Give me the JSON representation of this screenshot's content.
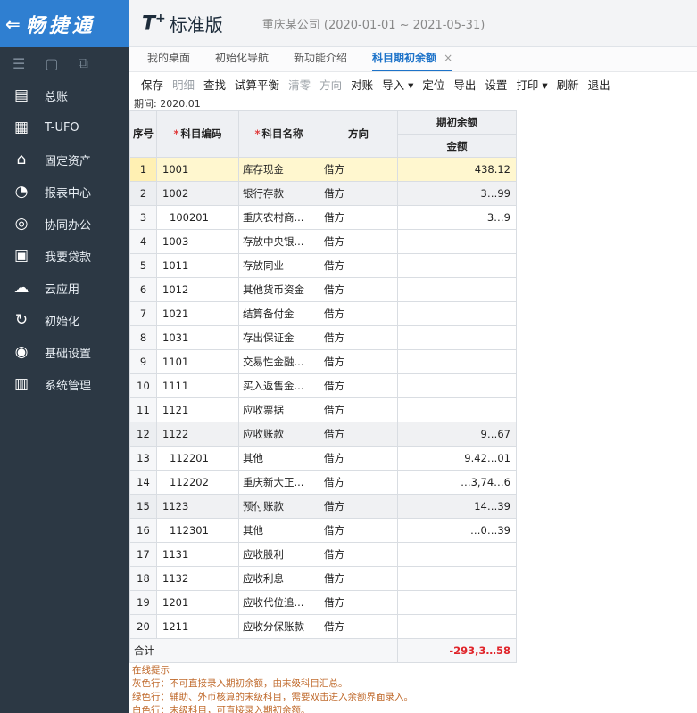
{
  "brand": {
    "arrow": "⇐",
    "name": "畅捷通"
  },
  "header": {
    "logo": "T",
    "logo_sup": "+",
    "edition": "标准版",
    "account_text": "重庆某公司 (2020-01-01 ~ 2021-05-31)"
  },
  "sidebar": {
    "tool_icons": [
      "menu-icon",
      "calendar-icon",
      "share-icon"
    ],
    "items": [
      {
        "icon": "ledger-icon",
        "glyph": "▤",
        "label": "总账"
      },
      {
        "icon": "ufo-icon",
        "glyph": "▦",
        "label": "T-UFO"
      },
      {
        "icon": "bank-icon",
        "glyph": "⌂",
        "label": "固定资产"
      },
      {
        "icon": "chart-icon",
        "glyph": "◔",
        "label": "报表中心"
      },
      {
        "icon": "collab-icon",
        "glyph": "◎",
        "label": "协同办公"
      },
      {
        "icon": "loan-icon",
        "glyph": "▣",
        "label": "我要贷款"
      },
      {
        "icon": "cloud-icon",
        "glyph": "☁",
        "label": "云应用"
      },
      {
        "icon": "init-icon",
        "glyph": "↻",
        "label": "初始化"
      },
      {
        "icon": "settings-icon",
        "glyph": "◉",
        "label": "基础设置"
      },
      {
        "icon": "system-icon",
        "glyph": "▥",
        "label": "系统管理"
      }
    ]
  },
  "tabs": [
    {
      "label": "我的桌面",
      "active": false
    },
    {
      "label": "初始化导航",
      "active": false
    },
    {
      "label": "新功能介绍",
      "active": false
    },
    {
      "label": "科目期初余额",
      "active": true,
      "close": "×"
    }
  ],
  "toolbar": [
    {
      "label": "保存",
      "enabled": true
    },
    {
      "label": "明细",
      "enabled": false
    },
    {
      "label": "查找",
      "enabled": true
    },
    {
      "label": "试算平衡",
      "enabled": true
    },
    {
      "label": "清零",
      "enabled": false
    },
    {
      "label": "方向",
      "enabled": false
    },
    {
      "label": "对账",
      "enabled": true
    },
    {
      "label": "导入 ▾",
      "enabled": true
    },
    {
      "label": "定位",
      "enabled": true
    },
    {
      "label": "导出",
      "enabled": true
    },
    {
      "label": "设置",
      "enabled": true
    },
    {
      "label": "打印 ▾",
      "enabled": true
    },
    {
      "label": "刷新",
      "enabled": true
    },
    {
      "label": "退出",
      "enabled": true
    }
  ],
  "period": "期间: 2020.01",
  "table": {
    "headers": {
      "index": "序号",
      "code": "科目编码",
      "name": "科目名称",
      "direction": "方向",
      "balance_group": "期初余额",
      "amount": "金额"
    },
    "rows": [
      {
        "index": "1",
        "code": "1001",
        "name": "库存现金",
        "direction": "借方",
        "amount": "438.12",
        "sub": false,
        "state": "sel"
      },
      {
        "index": "2",
        "code": "1002",
        "name": "银行存款",
        "direction": "借方",
        "amount": "3…99",
        "sub": false,
        "state": "gray"
      },
      {
        "index": "3",
        "code": "100201",
        "name": "重庆农村商...",
        "direction": "借方",
        "amount": "3…9",
        "sub": true,
        "state": ""
      },
      {
        "index": "4",
        "code": "1003",
        "name": "存放中央银...",
        "direction": "借方",
        "amount": "",
        "sub": false,
        "state": ""
      },
      {
        "index": "5",
        "code": "1011",
        "name": "存放同业",
        "direction": "借方",
        "amount": "",
        "sub": false,
        "state": ""
      },
      {
        "index": "6",
        "code": "1012",
        "name": "其他货币资金",
        "direction": "借方",
        "amount": "",
        "sub": false,
        "state": ""
      },
      {
        "index": "7",
        "code": "1021",
        "name": "结算备付金",
        "direction": "借方",
        "amount": "",
        "sub": false,
        "state": ""
      },
      {
        "index": "8",
        "code": "1031",
        "name": "存出保证金",
        "direction": "借方",
        "amount": "",
        "sub": false,
        "state": ""
      },
      {
        "index": "9",
        "code": "1101",
        "name": "交易性金融...",
        "direction": "借方",
        "amount": "",
        "sub": false,
        "state": ""
      },
      {
        "index": "10",
        "code": "1111",
        "name": "买入返售金...",
        "direction": "借方",
        "amount": "",
        "sub": false,
        "state": ""
      },
      {
        "index": "11",
        "code": "1121",
        "name": "应收票据",
        "direction": "借方",
        "amount": "",
        "sub": false,
        "state": ""
      },
      {
        "index": "12",
        "code": "1122",
        "name": "应收账款",
        "direction": "借方",
        "amount": "9…67",
        "sub": false,
        "state": "gray"
      },
      {
        "index": "13",
        "code": "112201",
        "name": "其他",
        "direction": "借方",
        "amount": "9.42…01",
        "sub": true,
        "state": ""
      },
      {
        "index": "14",
        "code": "112202",
        "name": "重庆新大正...",
        "direction": "借方",
        "amount": "…3,74…6",
        "sub": true,
        "state": ""
      },
      {
        "index": "15",
        "code": "1123",
        "name": "预付账款",
        "direction": "借方",
        "amount": "14…39",
        "sub": false,
        "state": "gray"
      },
      {
        "index": "16",
        "code": "112301",
        "name": "其他",
        "direction": "借方",
        "amount": "…0…39",
        "sub": true,
        "state": ""
      },
      {
        "index": "17",
        "code": "1131",
        "name": "应收股利",
        "direction": "借方",
        "amount": "",
        "sub": false,
        "state": ""
      },
      {
        "index": "18",
        "code": "1132",
        "name": "应收利息",
        "direction": "借方",
        "amount": "",
        "sub": false,
        "state": ""
      },
      {
        "index": "19",
        "code": "1201",
        "name": "应收代位追...",
        "direction": "借方",
        "amount": "",
        "sub": false,
        "state": ""
      },
      {
        "index": "20",
        "code": "1211",
        "name": "应收分保账款",
        "direction": "借方",
        "amount": "",
        "sub": false,
        "state": ""
      }
    ],
    "total_label": "合计",
    "total_amount": "-293,3…58"
  },
  "tips": {
    "title": "在线提示",
    "lines": [
      "灰色行：不可直接录入期初余额，由末级科目汇总。",
      "绿色行：辅助、外币核算的末级科目，需要双击进入余额界面录入。",
      "白色行：末级科目，可直接录入期初余额。"
    ]
  }
}
